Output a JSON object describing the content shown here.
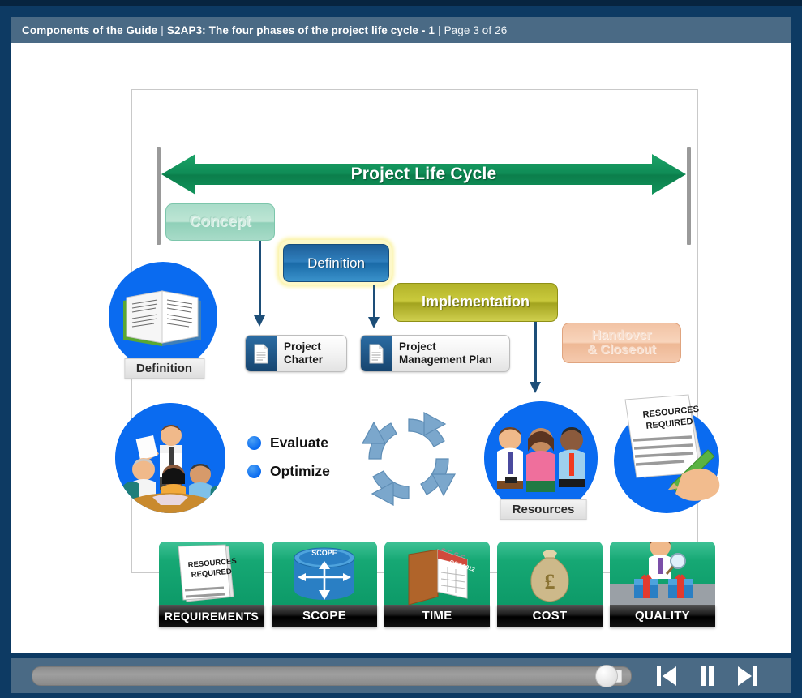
{
  "header": {
    "course_title": "Components of the Guide",
    "separator": "|",
    "lesson_title": "S2AP3: The four phases of the project life cycle - 1",
    "page_indicator": "Page 3 of 26"
  },
  "slide": {
    "timeline_label": "Project Life Cycle",
    "phases": [
      {
        "id": "concept",
        "label": "Concept",
        "state": "inactive",
        "color": "#a9dcc9"
      },
      {
        "id": "definition",
        "label": "Definition",
        "state": "active",
        "color": "#2f7fbd"
      },
      {
        "id": "implementation",
        "label": "Implementation",
        "state": "visited",
        "color": "#c9c93c"
      },
      {
        "id": "handover",
        "label": "Handover\n& Closeout",
        "state": "inactive",
        "color": "#f2c3a4"
      }
    ],
    "handover_line1": "Handover",
    "handover_line2": "& Closeout",
    "deliverables": [
      {
        "id": "project-charter",
        "line1": "Project",
        "line2": "Charter",
        "icon": "document-icon"
      },
      {
        "id": "project-management-plan",
        "line1": "Project",
        "line2": "Management Plan",
        "icon": "document-icon"
      }
    ],
    "badges": [
      {
        "id": "definition-badge",
        "caption": "Definition",
        "icon": "open-book-icon"
      },
      {
        "id": "team-meeting-badge",
        "caption": "",
        "icon": "team-meeting-icon"
      },
      {
        "id": "resources-badge",
        "caption": "Resources",
        "icon": "three-people-icon"
      },
      {
        "id": "resources-required-badge",
        "caption": "",
        "icon": "signing-document-icon"
      }
    ],
    "bullets": [
      {
        "label": "Evaluate",
        "color": "#0a6bf0"
      },
      {
        "label": "Optimize",
        "color": "#0a6bf0"
      }
    ],
    "cycle_icon": "circular-arrows-icon",
    "document_headings": {
      "resources_required_line1": "RESOURCES",
      "resources_required_line2": "REQUIRED"
    },
    "tiles": [
      {
        "id": "requirements",
        "label": "REQUIREMENTS",
        "icon": "stacked-papers-icon"
      },
      {
        "id": "scope",
        "label": "SCOPE",
        "icon": "cylinder-scope-icon",
        "art_caption": "SCOPE"
      },
      {
        "id": "time",
        "label": "TIME",
        "icon": "calendar-icon",
        "art_caption": "OCT 2012"
      },
      {
        "id": "cost",
        "label": "COST",
        "icon": "money-bag-icon",
        "art_caption": "£"
      },
      {
        "id": "quality",
        "label": "QUALITY",
        "icon": "inspector-gifts-icon"
      }
    ]
  },
  "player": {
    "seek_label": "Playback progress",
    "progress_percent": 94,
    "controls": [
      {
        "id": "previous",
        "icon": "previous-slide-icon",
        "label": "Previous"
      },
      {
        "id": "pause",
        "icon": "pause-icon",
        "label": "Pause"
      },
      {
        "id": "next",
        "icon": "next-slide-icon",
        "label": "Next"
      }
    ]
  },
  "colors": {
    "chrome_dark": "#07243f",
    "frame_navy": "#0d3a63",
    "header_slate": "#4a6a85",
    "timeline_green": "#0f8c56",
    "tile_green": "#0d9a68",
    "accent_blue": "#0a6bf0",
    "connector_navy": "#1d4e78"
  }
}
